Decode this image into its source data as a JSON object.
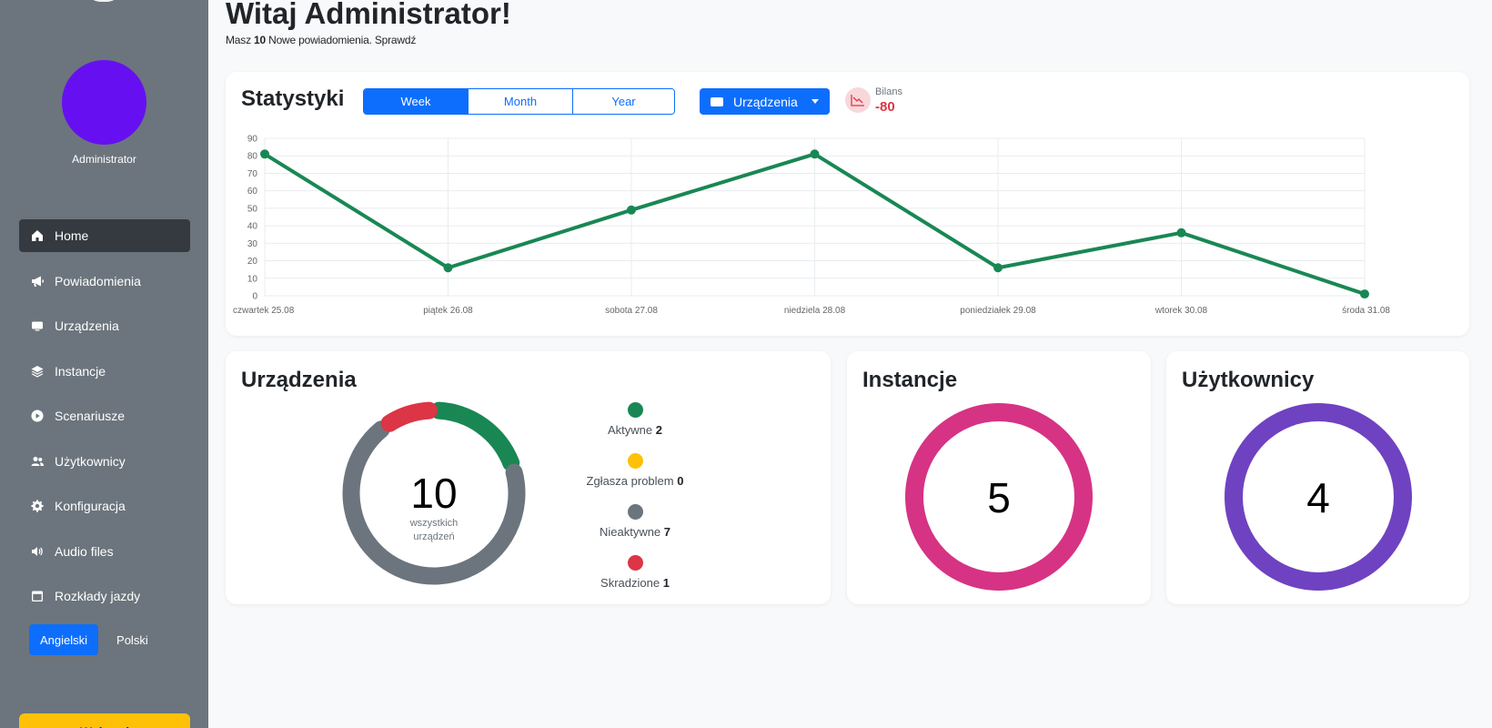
{
  "sidebar": {
    "username": "Administrator",
    "items": [
      {
        "label": "Home",
        "icon": "home-icon",
        "active": true
      },
      {
        "label": "Powiadomienia",
        "icon": "megaphone-icon"
      },
      {
        "label": "Urządzenia",
        "icon": "monitor-icon"
      },
      {
        "label": "Instancje",
        "icon": "layers-icon"
      },
      {
        "label": "Scenariusze",
        "icon": "play-circle-icon"
      },
      {
        "label": "Użytkownicy",
        "icon": "users-icon"
      },
      {
        "label": "Konfiguracja",
        "icon": "gear-icon"
      },
      {
        "label": "Audio files",
        "icon": "speaker-icon"
      },
      {
        "label": "Rozkłady jazdy",
        "icon": "calendar-icon"
      }
    ],
    "languages": [
      {
        "label": "Angielski",
        "active": true
      },
      {
        "label": "Polski"
      }
    ],
    "logout_label": "Wyloguj"
  },
  "header": {
    "greeting": "Witaj Administrator!",
    "sub_prefix": "Masz",
    "sub_count": "10",
    "sub_suffix": "Nowe powiadomienia. Sprawdź"
  },
  "stats": {
    "title": "Statystyki",
    "periods": [
      {
        "label": "Week",
        "active": true
      },
      {
        "label": "Month"
      },
      {
        "label": "Year"
      }
    ],
    "dropdown_label": "Urządzenia",
    "bilans_label": "Bilans",
    "bilans_value": "-80"
  },
  "chart_data": {
    "type": "line",
    "categories": [
      "czwartek 25.08",
      "piątek 26.08",
      "sobota 27.08",
      "niedziela 28.08",
      "poniedziałek 29.08",
      "wtorek 30.08",
      "środa 31.08"
    ],
    "series": [
      {
        "values": [
          81,
          16,
          49,
          81,
          16,
          36,
          1
        ]
      }
    ],
    "ylim": [
      0,
      90
    ],
    "yticks": [
      0,
      10,
      20,
      30,
      40,
      50,
      60,
      70,
      80,
      90
    ],
    "grid": true,
    "color": "#198754"
  },
  "devices": {
    "title": "Urządzenia",
    "total": "10",
    "total_label_1": "wszystkich",
    "total_label_2": "urządzeń",
    "legend": [
      {
        "label": "Aktywne",
        "value": 2,
        "color": "#198754"
      },
      {
        "label": "Zgłasza problem",
        "value": 0,
        "color": "#ffc107"
      },
      {
        "label": "Nieaktywne",
        "value": 7,
        "color": "#6c757d"
      },
      {
        "label": "Skradzione",
        "value": 1,
        "color": "#dc3545"
      }
    ]
  },
  "instances": {
    "title": "Instancje",
    "count": "5",
    "color": "#d63384"
  },
  "users": {
    "title": "Użytkownicy",
    "count": "4",
    "color": "#6f42c1"
  }
}
